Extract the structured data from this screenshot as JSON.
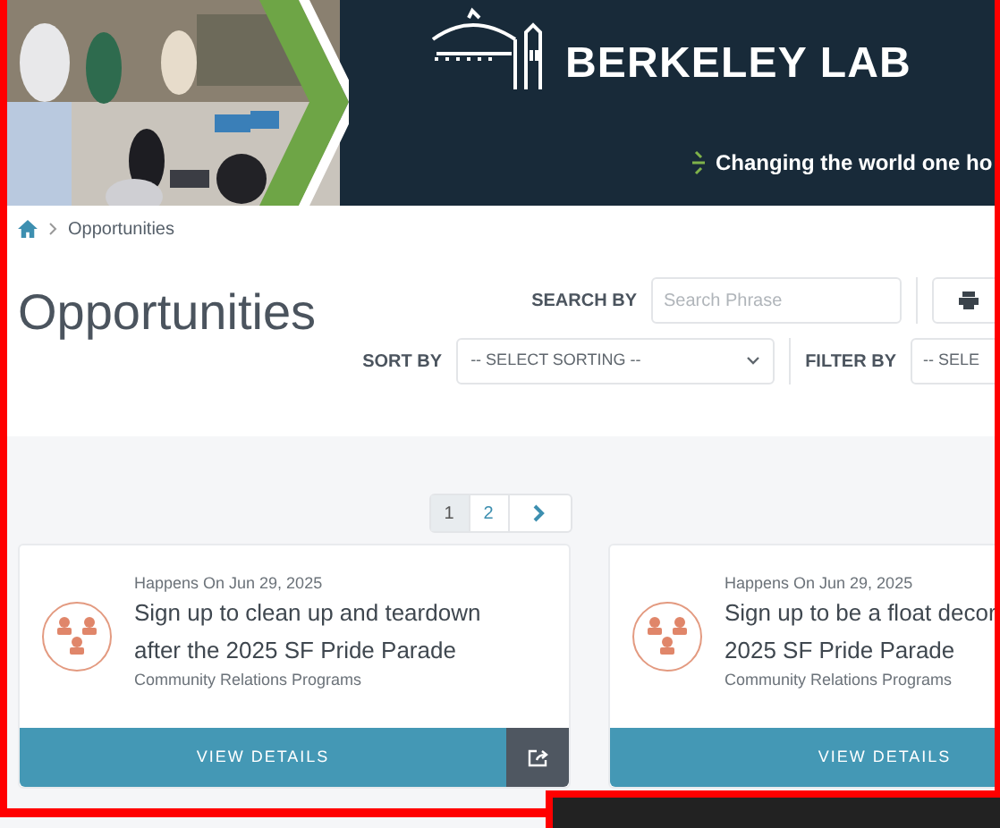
{
  "header": {
    "logo": "BERKELEY LAB",
    "tagline": "Changing the world one ho"
  },
  "breadcrumb": {
    "items": [
      "Opportunities"
    ]
  },
  "page_title": "Opportunities",
  "search": {
    "label": "SEARCH BY",
    "placeholder": "Search Phrase"
  },
  "sort": {
    "label": "SORT BY",
    "value": "-- SELECT SORTING --"
  },
  "filter": {
    "label": "FILTER BY",
    "value": "-- SELE"
  },
  "pagination": {
    "pages": [
      {
        "label": "1",
        "selected": true
      },
      {
        "label": "2",
        "selected": false
      }
    ]
  },
  "cards": [
    {
      "date": "Happens On Jun 29, 2025",
      "title_lines": [
        "Sign up to clean up and teardown",
        "after the 2025 SF Pride Parade"
      ],
      "category": "Community Relations Programs",
      "button": "VIEW DETAILS",
      "share": true
    },
    {
      "date": "Happens On Jun 29, 2025",
      "title_lines": [
        "Sign up to be a float decor",
        "2025 SF Pride Parade"
      ],
      "category": "Community Relations Programs",
      "button": "VIEW DETAILS",
      "share": false
    }
  ]
}
